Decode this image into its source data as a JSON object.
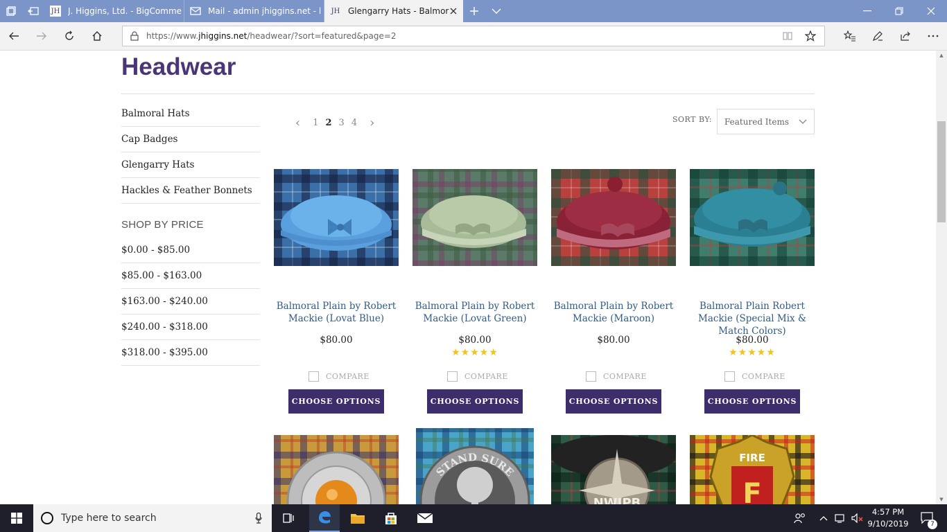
{
  "browser": {
    "tabs": [
      {
        "favicon": "JH",
        "title": "J. Higgins, Ltd. - BigComme"
      },
      {
        "favicon": "mail-icon",
        "title": "Mail - admin jhiggins.net - l"
      },
      {
        "favicon": "JH",
        "title": "Glengarry Hats - Balmor"
      }
    ],
    "url_prefix": "https://www.",
    "url_domain": "jhiggins.net",
    "url_path": "/headwear/?sort=featured&page=2"
  },
  "page": {
    "title": "Headwear",
    "categories": [
      {
        "label": "Balmoral Hats"
      },
      {
        "label": "Cap Badges"
      },
      {
        "label": "Glengarry Hats"
      },
      {
        "label": "Hackles & Feather Bonnets"
      }
    ],
    "shop_by_price_heading": "SHOP BY PRICE",
    "price_ranges": [
      {
        "label": "$0.00 - $85.00"
      },
      {
        "label": "$85.00 - $163.00"
      },
      {
        "label": "$163.00 - $240.00"
      },
      {
        "label": "$240.00 - $318.00"
      },
      {
        "label": "$318.00 - $395.00"
      }
    ],
    "pagination": {
      "prev": "‹",
      "pages": [
        "1",
        "2",
        "3",
        "4"
      ],
      "current": "2",
      "next": "›"
    },
    "sort": {
      "label": "SORT BY:",
      "value": "Featured Items"
    },
    "products": [
      {
        "name": "Balmoral Plain by Robert Mackie (Lovat Blue)",
        "price": "$80.00",
        "stars": "",
        "compare": "COMPARE",
        "button": "CHOOSE OPTIONS",
        "hat_color": "#5aa0de"
      },
      {
        "name": "Balmoral Plain by Robert Mackie (Lovat Green)",
        "price": "$80.00",
        "stars": "★★★★★",
        "compare": "COMPARE",
        "button": "CHOOSE OPTIONS",
        "hat_color": "#a8bb98"
      },
      {
        "name": "Balmoral Plain by Robert Mackie (Maroon)",
        "price": "$80.00",
        "stars": "",
        "compare": "COMPARE",
        "button": "CHOOSE OPTIONS",
        "hat_color": "#8a2237"
      },
      {
        "name": "Balmoral Plain Robert Mackie (Special Mix & Match Colors)",
        "price": "$80.00",
        "stars": "★★★★★",
        "compare": "COMPARE",
        "button": "CHOOSE OPTIONS",
        "hat_color": "#2b7f93"
      }
    ],
    "badge_row": [
      {
        "badge": "amber-stone-badge"
      },
      {
        "text": "STAND SURE"
      },
      {
        "text": "NWIPB"
      },
      {
        "text": "FIRE"
      }
    ]
  },
  "taskbar": {
    "search_placeholder": "Type here to search",
    "time": "4:57 PM",
    "date": "9/10/2019",
    "notification_count": "7"
  },
  "colors": {
    "accent": "#3d2e6b",
    "title": "#4a3577",
    "link": "#2f5a8a",
    "stars": "#f0c419"
  }
}
